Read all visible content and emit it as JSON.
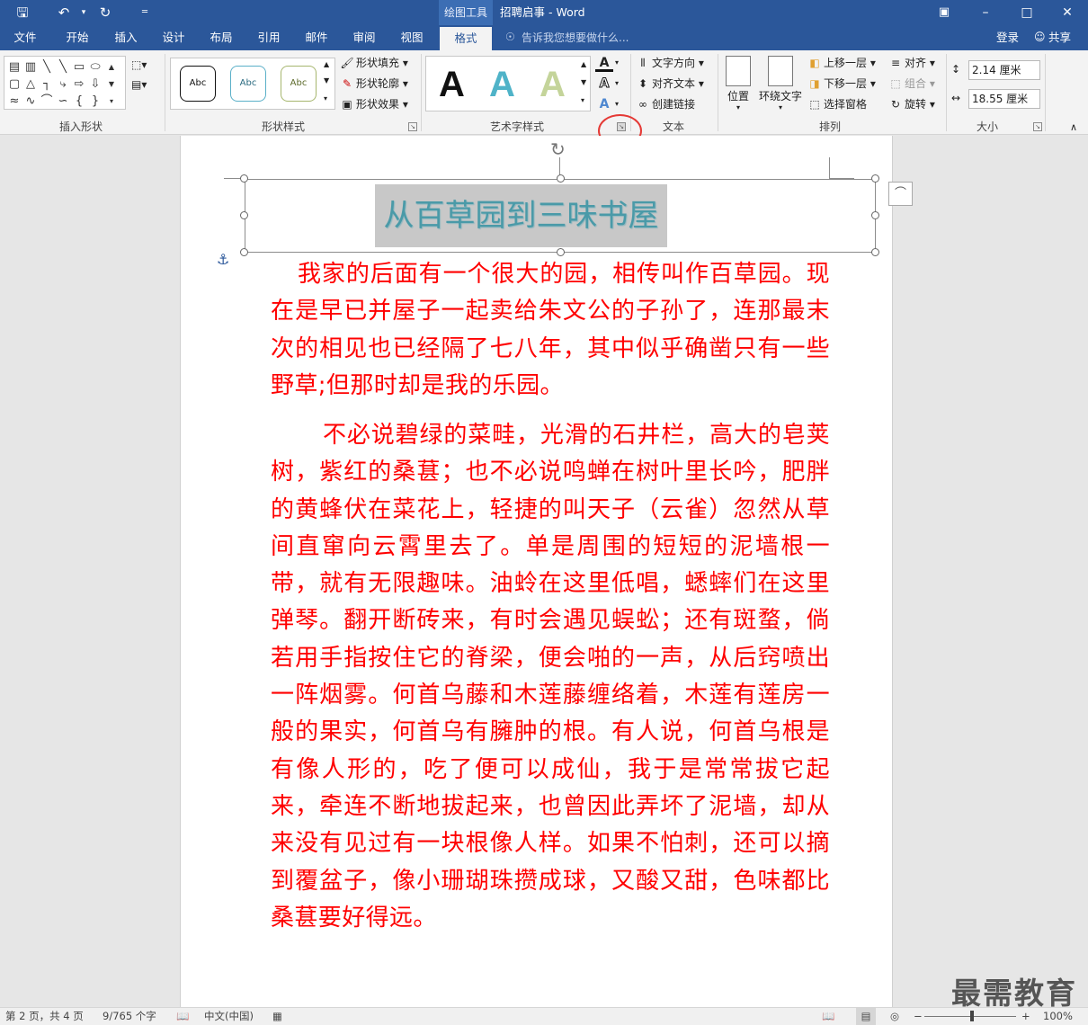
{
  "titlebar": {
    "contextual_tools": "绘图工具",
    "doc_title": "招聘启事 - Word",
    "save_icon": "save-icon",
    "undo_icon": "undo-icon",
    "redo_icon": "redo-icon"
  },
  "tabs": {
    "file": "文件",
    "home": "开始",
    "insert": "插入",
    "design": "设计",
    "layout": "布局",
    "references": "引用",
    "mailings": "邮件",
    "review": "审阅",
    "view": "视图",
    "format": "格式",
    "tell_me": "告诉我您想要做什么...",
    "login": "登录",
    "share": "共享"
  },
  "ribbon": {
    "groups": {
      "insert_shapes": "插入形状",
      "shape_styles": "形状样式",
      "wordart_styles": "艺术字样式",
      "text": "文本",
      "arrange": "排列",
      "size": "大小"
    },
    "shape_style_samples": [
      "Abc",
      "Abc",
      "Abc"
    ],
    "shape_fill": "形状填充",
    "shape_outline": "形状轮廓",
    "shape_effects": "形状效果",
    "wordart_samples": [
      "A",
      "A",
      "A"
    ],
    "text_direction": "文字方向",
    "align_text": "对齐文本",
    "create_link": "创建链接",
    "position": "位置",
    "wrap_text": "环绕文字",
    "bring_forward": "上移一层",
    "send_backward": "下移一层",
    "selection_pane": "选择窗格",
    "align": "对齐",
    "group": "组合",
    "rotate": "旋转",
    "height": "2.14 厘米",
    "width": "18.55 厘米"
  },
  "document": {
    "wordart_title": "从百草园到三味书屋",
    "paragraph1": "我家的后面有一个很大的园，相传叫作百草园。现在是早已并屋子一起卖给朱文公的子孙了，连那最末次的相见也已经隔了七八年，其中似乎确凿只有一些野草;但那时却是我的乐园。",
    "paragraph2": "不必说碧绿的菜畦，光滑的石井栏，高大的皂荚树，紫红的桑葚；也不必说鸣蝉在树叶里长吟，肥胖的黄蜂伏在菜花上，轻捷的叫天子（云雀）忽然从草间直窜向云霄里去了。单是周围的短短的泥墙根一带，就有无限趣味。油蛉在这里低唱，蟋蟀们在这里弹琴。翻开断砖来，有时会遇见蜈蚣；还有斑蝥，倘若用手指按住它的脊梁，便会啪的一声，从后窍喷出一阵烟雾。何首乌藤和木莲藤缠络着，木莲有莲房一般的果实，何首乌有臃肿的根。有人说，何首乌根是有像人形的，吃了便可以成仙，我于是常常拔它起来，牵连不断地拔起来，也曾因此弄坏了泥墙，却从来没有见过有一块根像人样。如果不怕刺，还可以摘到覆盆子，像小珊瑚珠攒成球，又酸又甜，色味都比桑葚要好得远。"
  },
  "status": {
    "page": "第 2 页，共 4 页",
    "words": "9/765 个字",
    "language": "中文(中国)",
    "zoom": "100%"
  },
  "watermark": "最需教育",
  "colors": {
    "accent": "#2b579a",
    "body_text": "#ff0000",
    "wordart": "#4a9aa8",
    "highlight_circle": "#e53935"
  }
}
